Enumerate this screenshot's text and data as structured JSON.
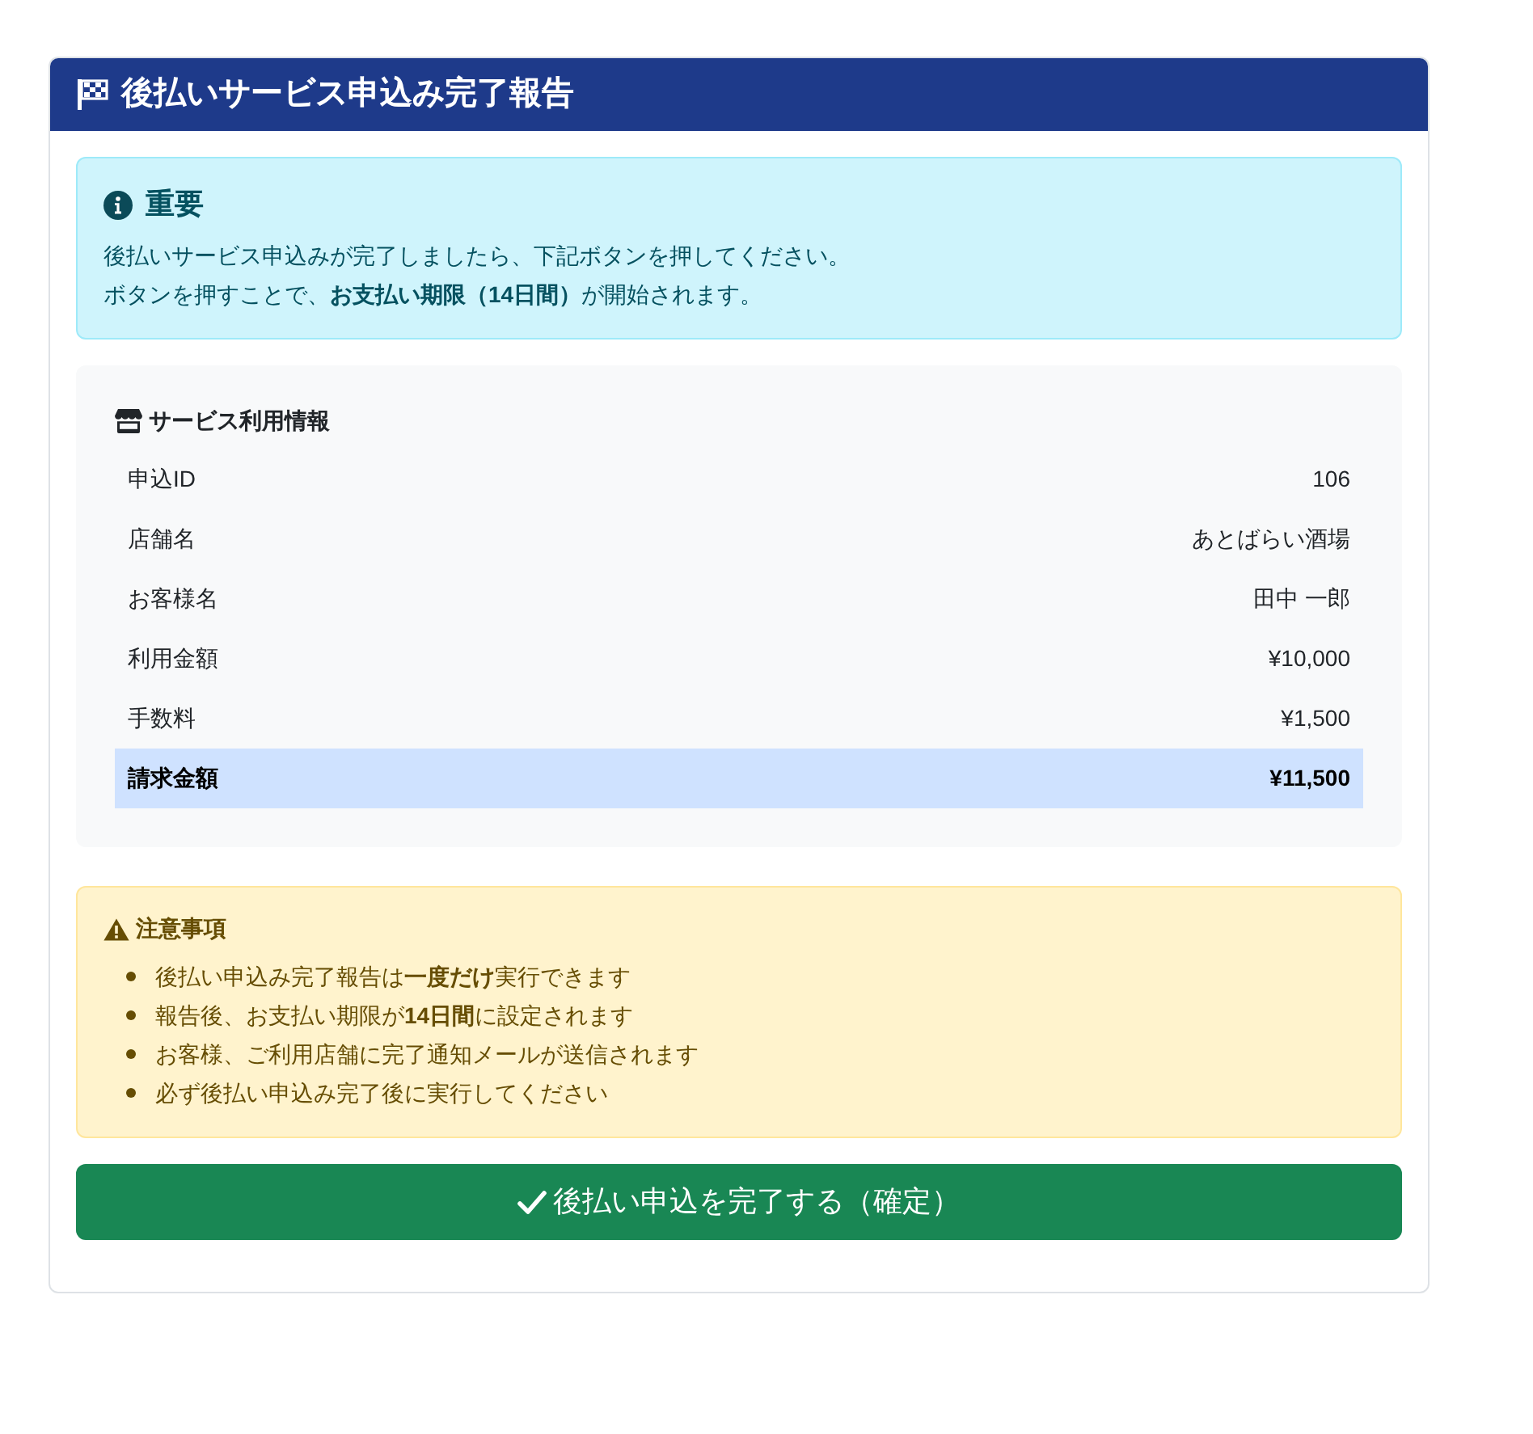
{
  "header": {
    "title": "後払いサービス申込み完了報告"
  },
  "notice": {
    "heading": "重要",
    "lines": [
      "後払いサービス申込みが完了しましたら、下記ボタンを押してください。",
      "ボタンを押すことで、**お支払い期限（14日間）**が開始されます。"
    ]
  },
  "service_info": {
    "heading": "サービス利用情報",
    "rows": [
      {
        "label": "申込ID",
        "value": "106",
        "highlighted": false
      },
      {
        "label": "店舗名",
        "value": "あとばらい酒場",
        "highlighted": false
      },
      {
        "label": "お客様名",
        "value": "田中 一郎",
        "highlighted": false
      },
      {
        "label": "利用金額",
        "value": "¥10,000",
        "highlighted": false
      },
      {
        "label": "手数料",
        "value": "¥1,500",
        "highlighted": false
      },
      {
        "label": "請求金額",
        "value": "¥11,500",
        "highlighted": true
      }
    ]
  },
  "cautions": {
    "heading": "注意事項",
    "items": [
      "後払い申込み完了報告は**一度だけ**実行できます",
      "報告後、お支払い期限が**14日間**に設定されます",
      "お客様、ご利用店舗に完了通知メールが送信されます",
      "必ず後払い申込み完了後に実行してください"
    ]
  },
  "confirm_button": {
    "label": "後払い申込を完了する（確定）"
  }
}
